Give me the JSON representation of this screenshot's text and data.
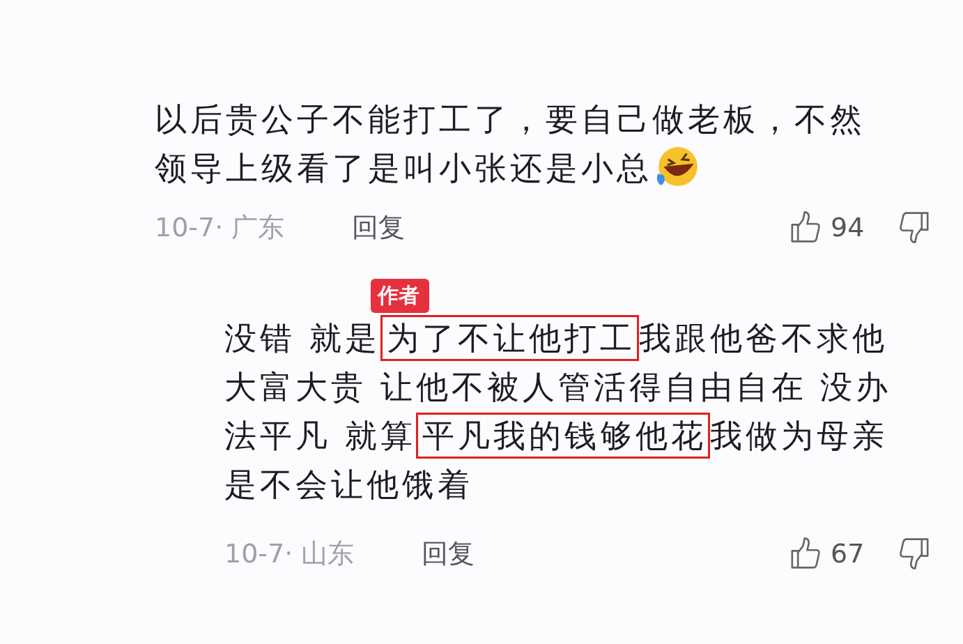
{
  "comments": [
    {
      "is_author": false,
      "lines": [
        [
          {
            "kind": "text",
            "text": "以后贵公子不能打工了，要自己做老板，不然"
          }
        ],
        [
          {
            "kind": "text",
            "text": "领导上级看了是叫小张还是小总"
          },
          {
            "kind": "emoji"
          }
        ]
      ],
      "meta": "10-7· 广东",
      "reply_label": "回复",
      "likes": "94"
    },
    {
      "is_author": true,
      "badge": "作者",
      "lines": [
        [
          {
            "kind": "text",
            "text": "没错 就是"
          },
          {
            "kind": "highlight",
            "text": "为了不让他打工"
          },
          {
            "kind": "text",
            "text": " 我跟他爸不求他"
          }
        ],
        [
          {
            "kind": "text",
            "text": "大富大贵 让他不被人管活得自由自在 没办"
          }
        ],
        [
          {
            "kind": "text",
            "text": "法平凡 就算"
          },
          {
            "kind": "highlight",
            "text": "平凡我的钱够他花"
          },
          {
            "kind": "text",
            "text": " 我做为母亲"
          }
        ],
        [
          {
            "kind": "text",
            "text": "是不会让他饿着"
          }
        ]
      ],
      "meta": "10-7· 山东",
      "reply_label": "回复",
      "likes": "67"
    }
  ]
}
